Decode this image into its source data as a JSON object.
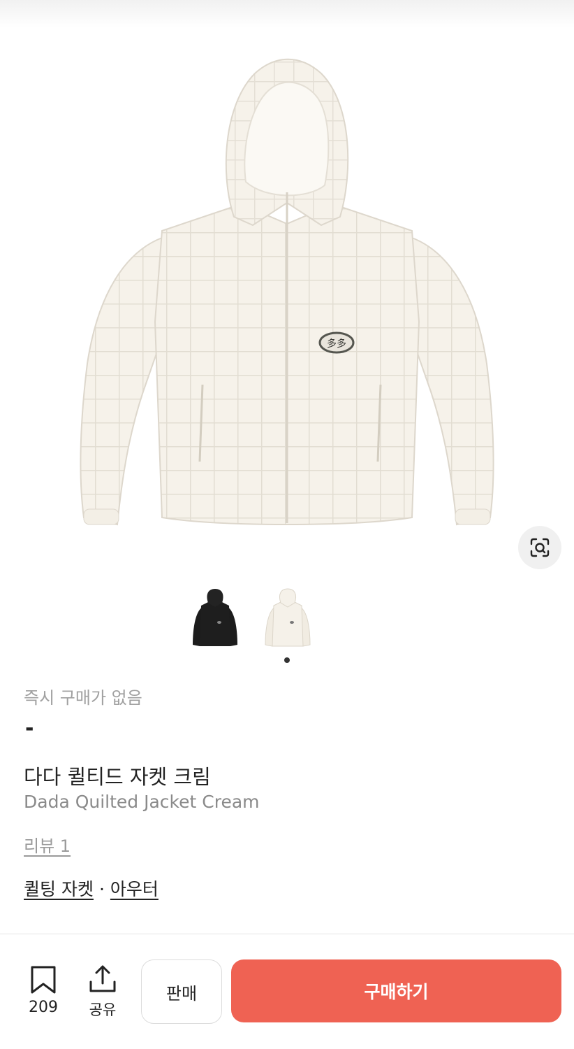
{
  "product": {
    "instant_label": "즉시 구매가 없음",
    "price": "-",
    "name_ko": "다다 퀼티드 자켓 크림",
    "name_en": "Dada Quilted Jacket Cream",
    "review_label": "리뷰 1",
    "categories": [
      "퀼팅 자켓",
      "아우터"
    ],
    "category_separator": "·",
    "logo_text": "多多"
  },
  "icons": {
    "scan": "lens-scan-icon",
    "wish": "bookmark-icon",
    "share": "share-icon"
  },
  "bottom_bar": {
    "wish_count": "209",
    "share_label": "공유",
    "sell_label": "판매",
    "buy_label": "구매하기"
  },
  "colors": {
    "buy_button": "#ef6253",
    "jacket_cream": "#f6f2ea",
    "jacket_black": "#1c1c1c"
  }
}
